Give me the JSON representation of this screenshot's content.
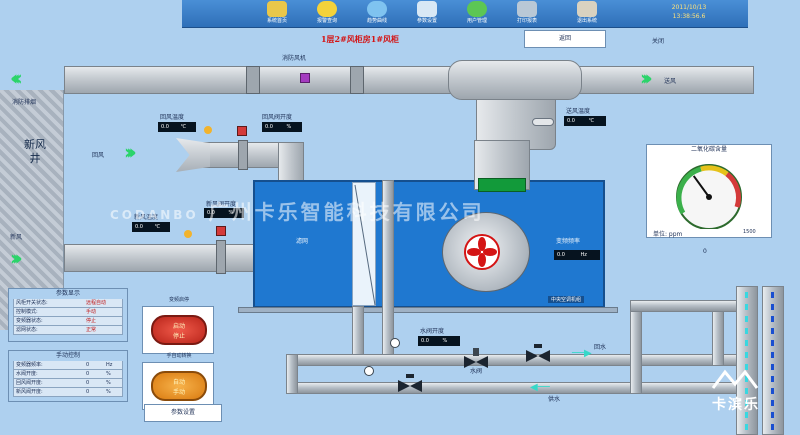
{
  "toolbar": {
    "buttons": [
      {
        "label": "系统首页",
        "icon": "home-icon"
      },
      {
        "label": "报警查询",
        "icon": "alarm-icon"
      },
      {
        "label": "趋势曲线",
        "icon": "trend-icon"
      },
      {
        "label": "参数设置",
        "icon": "settings-icon"
      },
      {
        "label": "用户管理",
        "icon": "user-icon"
      },
      {
        "label": "打印报表",
        "icon": "printer-icon"
      },
      {
        "label": "退出系统",
        "icon": "exit-icon"
      }
    ],
    "date": "2011/10/13",
    "time": "13:38:56.6"
  },
  "top_right": {
    "button_label": "返回",
    "text": "关闭"
  },
  "title": "1层2#风柜房1#风柜",
  "labels": {
    "fire_damper": "消防风机",
    "fire_side": "消防排烟",
    "return_air": "回风",
    "supply_air": "送风",
    "shaft": "新风井",
    "fresh_air": "新风",
    "return_air_temp": "回风温度",
    "return_valve": "回风阀开度",
    "fresh_valve": "新风阀开度",
    "fresh_temp": "新风温度",
    "supply_temp": "送风温度",
    "filter": "滤网",
    "fan_freq": "变频频率",
    "water_valve": "水阀开度",
    "water_valve_name": "水阀",
    "return_water": "回水",
    "supply_water": "供水",
    "ahu_name": "中央空调机组"
  },
  "readouts": {
    "return_air_temp": {
      "value": "0.0",
      "unit": "℃"
    },
    "return_valve": {
      "value": "0.0",
      "unit": "%"
    },
    "supply_temp": {
      "value": "0.0",
      "unit": "℃"
    },
    "fresh_valve": {
      "value": "0.0",
      "unit": "%"
    },
    "fresh_temp": {
      "value": "0.0",
      "unit": "℃"
    },
    "fan_freq": {
      "value": "0.0",
      "unit": "Hz"
    },
    "water_valve": {
      "value": "0.0",
      "unit": "%"
    }
  },
  "co2": {
    "title": "二氧化碳含量",
    "unit": "单位: ppm",
    "value": "0",
    "level": 0.35,
    "scale_max": "1500"
  },
  "params": {
    "title": "参数显示",
    "rows": [
      {
        "k": "风柜开关状态:",
        "v": "远程自动",
        "u": ""
      },
      {
        "k": "控制模式:",
        "v": "手动",
        "u": ""
      },
      {
        "k": "变频器状态:",
        "v": "停止",
        "u": ""
      },
      {
        "k": "滤网状态:",
        "v": "正常",
        "u": ""
      }
    ]
  },
  "manual": {
    "title": "手动控制",
    "rows": [
      {
        "k": "变频器频率:",
        "v": "0",
        "u": "Hz"
      },
      {
        "k": "水阀开度:",
        "v": "0",
        "u": "%"
      },
      {
        "k": "回风阀开度:",
        "v": "0",
        "u": "%"
      },
      {
        "k": "新风阀开度:",
        "v": "0",
        "u": "%"
      }
    ]
  },
  "controls": {
    "start_stop": {
      "title": "变频启停",
      "line1": "启动",
      "line2": "停止"
    },
    "auto_manual": {
      "title": "手自动转换",
      "line1": "自动",
      "line2": "手动"
    },
    "param_button": "参数设置"
  },
  "watermark": {
    "brand": "CODANBO",
    "company": "广州卡乐智能科技有限公司",
    "corner_brand": "卡滨乐"
  },
  "colors": {
    "background": "#aed0ef",
    "ahu": "#1f78d0",
    "arrow": "#2bd46a",
    "alarm_red": "#d41414"
  }
}
